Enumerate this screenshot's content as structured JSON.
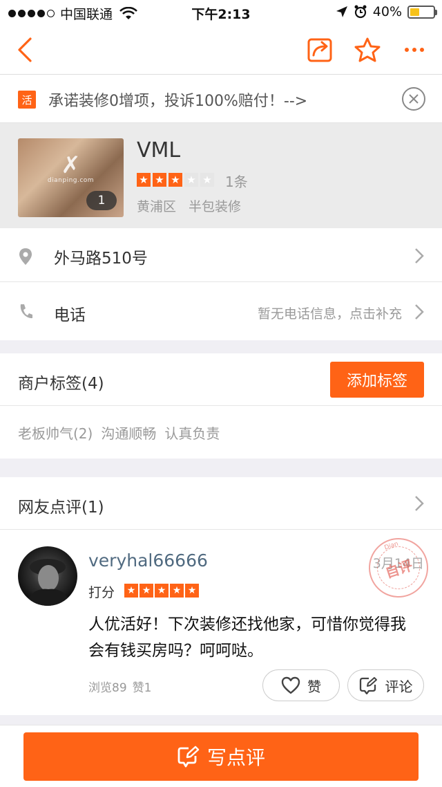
{
  "status_bar": {
    "carrier": "中国联通",
    "time": "下午2:13",
    "battery": "40%",
    "battery_level": 0.4
  },
  "navbar": {
    "back_icon": "chevron-left-icon",
    "share_icon": "share-icon",
    "favorite_icon": "star-outline-icon",
    "more_icon": "more-dots-icon",
    "accent_color": "#ff6316"
  },
  "promo": {
    "badge": "活",
    "text": "承诺装修0增项，投诉100%赔付！-->",
    "close_icon": "close-circle-icon"
  },
  "shop": {
    "name": "VML",
    "photo_count": "1",
    "photo_watermark": "dianping.com",
    "rating": 3,
    "rating_max": 5,
    "review_count": "1条",
    "district": "黄浦区",
    "category": "半包装修"
  },
  "address": {
    "text": "外马路510号",
    "icon": "location-pin-icon"
  },
  "phone": {
    "label": "电话",
    "hint": "暂无电话信息，点击补充",
    "icon": "phone-icon"
  },
  "merchant_tags": {
    "title": "商户标签(4)",
    "add_button": "添加标签",
    "tags": [
      "老板帅气(2)",
      "沟通顺畅",
      "认真负责"
    ]
  },
  "reviews_section": {
    "title": "网友点评(1)"
  },
  "review": {
    "username": "veryhal66666",
    "date": "3月14日",
    "stamp_text": "自评",
    "stamp_arc_text": "Dian",
    "rating_label": "打分",
    "rating": 5,
    "text": "人优活好！下次装修还找他家，可惜你觉得我会有钱买房吗？呵呵哒。",
    "views": "浏览89",
    "likes": "赞1",
    "like_button": "赞",
    "comment_button": "评论"
  },
  "bottom": {
    "write_review_button": "写点评"
  }
}
